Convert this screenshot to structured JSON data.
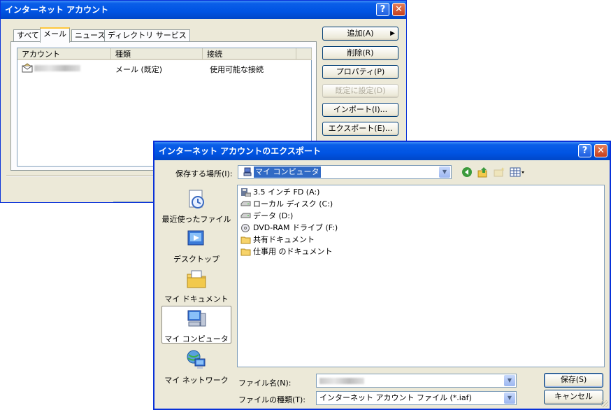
{
  "account_window": {
    "title": "インターネット アカウント",
    "tabs": [
      "すべて",
      "メール",
      "ニュース",
      "ディレクトリ サービス"
    ],
    "columns": [
      "アカウント",
      "種類",
      "接続"
    ],
    "rows": [
      {
        "type": "メール (既定)",
        "connection": "使用可能な接続"
      }
    ],
    "buttons": {
      "add": "追加(A)",
      "remove": "削除(R)",
      "properties": "プロパティ(P)",
      "set_default": "既定に設定(D)",
      "import": "インポート(I)...",
      "export": "エクスポート(E)..."
    }
  },
  "export_dialog": {
    "title": "インターネット アカウントのエクスポート",
    "save_in_label": "保存する場所(I):",
    "save_in_value": "マイ コンピュータ",
    "places": [
      "最近使ったファイル",
      "デスクトップ",
      "マイ ドキュメント",
      "マイ コンピュータ",
      "マイ ネットワーク"
    ],
    "files": [
      "3.5 インチ FD (A:)",
      "ローカル ディスク (C:)",
      "データ (D:)",
      "DVD-RAM ドライブ (F:)",
      "共有ドキュメント",
      "仕事用 のドキュメント"
    ],
    "filename_label": "ファイル名(N):",
    "filetype_label": "ファイルの種類(T):",
    "filetype_value": "インターネット アカウント ファイル (*.iaf)",
    "save_button": "保存(S)",
    "cancel_button": "キャンセル"
  },
  "title_buttons": {
    "help": "?",
    "close": "✕"
  },
  "add_arrow": "▶"
}
